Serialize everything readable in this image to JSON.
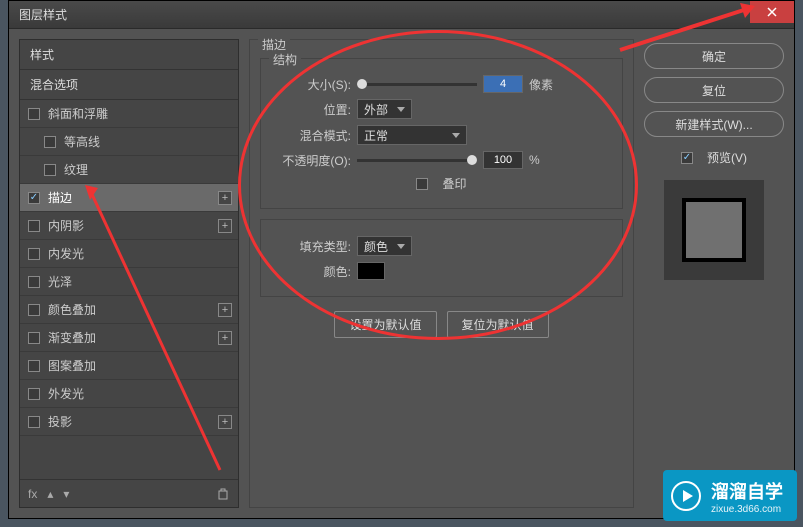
{
  "title": "图层样式",
  "close_icon": "×",
  "left": {
    "header_styles": "样式",
    "header_blend": "混合选项",
    "items": [
      {
        "label": "斜面和浮雕",
        "checked": false,
        "indent": false,
        "plus": false
      },
      {
        "label": "等高线",
        "checked": false,
        "indent": true,
        "plus": false
      },
      {
        "label": "纹理",
        "checked": false,
        "indent": true,
        "plus": false
      },
      {
        "label": "描边",
        "checked": true,
        "indent": false,
        "plus": true,
        "selected": true
      },
      {
        "label": "内阴影",
        "checked": false,
        "indent": false,
        "plus": true
      },
      {
        "label": "内发光",
        "checked": false,
        "indent": false,
        "plus": false
      },
      {
        "label": "光泽",
        "checked": false,
        "indent": false,
        "plus": false
      },
      {
        "label": "颜色叠加",
        "checked": false,
        "indent": false,
        "plus": true
      },
      {
        "label": "渐变叠加",
        "checked": false,
        "indent": false,
        "plus": true
      },
      {
        "label": "图案叠加",
        "checked": false,
        "indent": false,
        "plus": false
      },
      {
        "label": "外发光",
        "checked": false,
        "indent": false,
        "plus": false
      },
      {
        "label": "投影",
        "checked": false,
        "indent": false,
        "plus": true
      }
    ],
    "fx_label": "fx"
  },
  "center": {
    "section": "描边",
    "struct": "结构",
    "size_label": "大小(S):",
    "size_value": "4",
    "size_unit": "像素",
    "position_label": "位置:",
    "position_value": "外部",
    "blend_label": "混合模式:",
    "blend_value": "正常",
    "opacity_label": "不透明度(O):",
    "opacity_value": "100",
    "opacity_unit": "%",
    "overprint": "叠印",
    "fill_type_label": "填充类型:",
    "fill_type_value": "颜色",
    "color_label": "颜色:",
    "default_set": "设置为默认值",
    "default_reset": "复位为默认值"
  },
  "right": {
    "ok": "确定",
    "reset": "复位",
    "new_style": "新建样式(W)...",
    "preview": "预览(V)"
  },
  "watermark": {
    "main": "溜溜自学",
    "sub": "zixue.3d66.com"
  }
}
